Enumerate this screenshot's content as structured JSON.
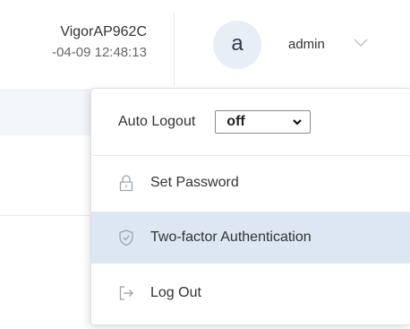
{
  "header": {
    "device_name": "VigorAP962C",
    "device_time": "-04-09 12:48:13",
    "avatar_letter": "a",
    "username": "admin"
  },
  "user_menu": {
    "auto_logout": {
      "label": "Auto Logout",
      "selected": "off"
    },
    "items": [
      {
        "label": "Set Password",
        "icon": "lock-icon"
      },
      {
        "label": "Two-factor Authentication",
        "icon": "shield-check-icon",
        "highlighted": true
      },
      {
        "label": "Log Out",
        "icon": "logout-icon"
      }
    ]
  },
  "colors": {
    "highlight": "#dde6f3",
    "avatar_bg": "#e8eef6",
    "icon_gray": "#9aa3ad"
  }
}
